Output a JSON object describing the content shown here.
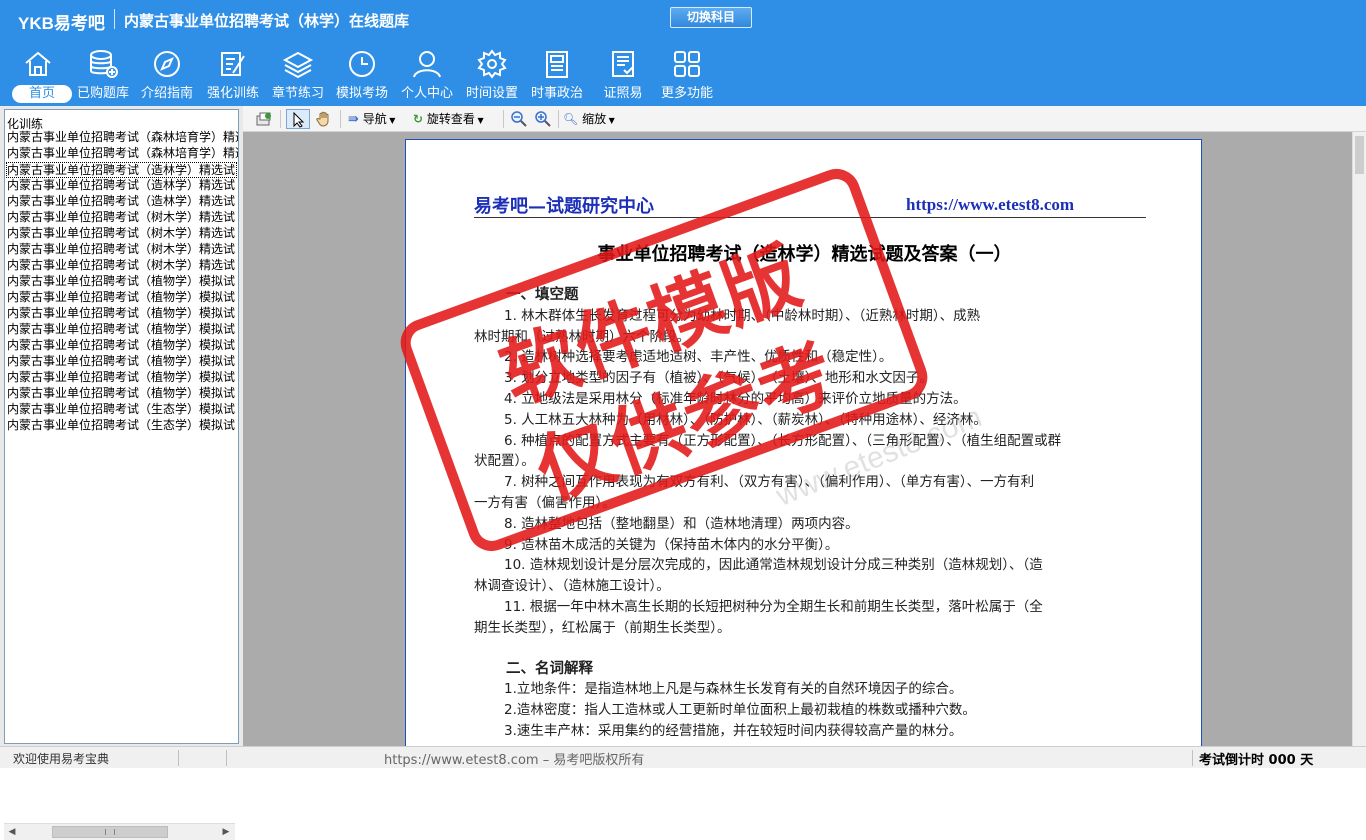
{
  "header": {
    "brand": "YKB易考吧",
    "app_title": "内蒙古事业单位招聘考试（林学）在线题库",
    "switch_button": "切换科目"
  },
  "nav": [
    {
      "label": "首页",
      "icon": "home-icon"
    },
    {
      "label": "已购题库",
      "icon": "database-icon"
    },
    {
      "label": "介绍指南",
      "icon": "compass-icon"
    },
    {
      "label": "强化训练",
      "icon": "edit-icon"
    },
    {
      "label": "章节练习",
      "icon": "layers-icon"
    },
    {
      "label": "模拟考场",
      "icon": "clock-icon"
    },
    {
      "label": "个人中心",
      "icon": "user-icon"
    },
    {
      "label": "时间设置",
      "icon": "gear-icon"
    },
    {
      "label": "时事政治",
      "icon": "newspaper-icon"
    },
    {
      "label": "证照易",
      "icon": "certificate-icon"
    },
    {
      "label": "更多功能",
      "icon": "grid-icon"
    }
  ],
  "left_panel": {
    "header": "化训练",
    "items": [
      "内蒙古事业单位招聘考试（森林培育学）精选",
      "内蒙古事业单位招聘考试（森林培育学）精选",
      "内蒙古事业单位招聘考试（造林学）精选试",
      "内蒙古事业单位招聘考试（造林学）精选试",
      "内蒙古事业单位招聘考试（造林学）精选试",
      "内蒙古事业单位招聘考试（树木学）精选试",
      "内蒙古事业单位招聘考试（树木学）精选试",
      "内蒙古事业单位招聘考试（树木学）精选试",
      "内蒙古事业单位招聘考试（树木学）精选试",
      "内蒙古事业单位招聘考试（植物学）模拟试",
      "内蒙古事业单位招聘考试（植物学）模拟试",
      "内蒙古事业单位招聘考试（植物学）模拟试",
      "内蒙古事业单位招聘考试（植物学）模拟试",
      "内蒙古事业单位招聘考试（植物学）模拟试",
      "内蒙古事业单位招聘考试（植物学）模拟试",
      "内蒙古事业单位招聘考试（植物学）模拟试",
      "内蒙古事业单位招聘考试（植物学）模拟试",
      "内蒙古事业单位招聘考试（生态学）模拟试",
      "内蒙古事业单位招聘考试（生态学）模拟试"
    ],
    "selected_index": 2
  },
  "toolbar": {
    "nav_label": "导航",
    "rotate_label": "旋转查看",
    "zoom_label": "缩放"
  },
  "document": {
    "head_left": "易考吧—试题研究中心",
    "head_right": "https://www.etest8.com",
    "title": "事业单位招聘考试（造林学）精选试题及答案（一）",
    "section1_head": "一、填空题",
    "lines": [
      "1. 林木群体生长发育过程可分为幼林时期、（中龄林时期）、（近熟林时期）、成熟",
      "林时期和（过熟林时期）六个阶段。",
      "2. 造林树种选择要考虑适地适树、丰产性、优质性和（稳定性）。",
      "3. 划分立地类型的因子有（植被）、（气候）、（土壤）、地形和水文因子。",
      "4. 立地级法是采用林分（标准年龄时林分的平均高）来评价立地质量的方法。",
      "5. 人工林五大林种为（用材林）、（防护林）、（薪炭林）、（特种用途林）、经济林。",
      "6. 种植点的配置方式主要有（正方形配置）、（长方形配置）、（三角形配置）、（植生组配置或群",
      "状配置）。",
      "7. 树种之间互作用表现为有双方有利、（双方有害）、（偏利作用）、（单方有害）、一方有利",
      "一方有害（偏害作用）。",
      "8. 造林整地包括（整地翻垦）和（造林地清理）两项内容。",
      "9. 造林苗木成活的关键为（保持苗木体内的水分平衡）。",
      "10. 造林规划设计是分层次完成的，因此通常造林规划设计分成三种类别（造林规划）、（造",
      "林调查设计）、（造林施工设计）。",
      "11. 根据一年中林木高生长期的长短把树种分为全期生长和前期生长类型，落叶松属于（全",
      "期生长类型），红松属于（前期生长类型）。"
    ],
    "section2_head": "二、名词解释",
    "defs": [
      "1.立地条件：是指造林地上凡是与森林生长发育有关的自然环境因子的综合。",
      "2.造林密度：指人工造林或人工更新时单位面积上最初栽植的株数或播种穴数。",
      "3.速生丰产林：采用集约的经营措施，并在较短时间内获得较高产量的林分。"
    ]
  },
  "stamp": {
    "line1": "软件模版",
    "line2": "仅供参考",
    "watermark": "www.etest8.com",
    "color": "#e21818"
  },
  "status": {
    "left": "欢迎使用易考宝典",
    "center": "https://www.etest8.com – 易考吧版权所有",
    "right": "考试倒计时 000 天"
  },
  "colors": {
    "header_bg": "#2f8fe6",
    "doc_heading": "#1c2fb8"
  }
}
